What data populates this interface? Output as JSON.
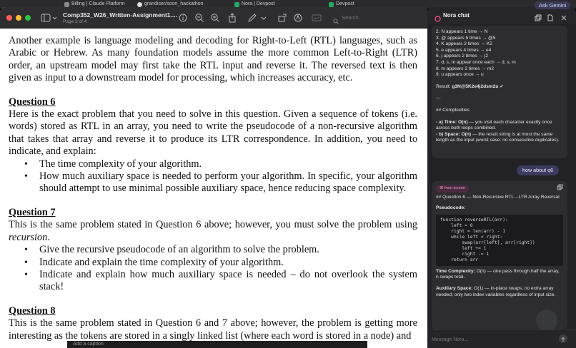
{
  "browser_tabs": [
    {
      "label": "Billing | Claude Platform",
      "icon": "claude-icon"
    },
    {
      "label": "grandiser/soon_hackathon",
      "icon": "github-icon"
    },
    {
      "label": "Nora | Devpost",
      "icon": "devpost-icon"
    },
    {
      "label": "Devpost",
      "icon": "devpost-icon"
    }
  ],
  "preview": {
    "title": "Comp352_W26_Written-Assignment1....",
    "subtitle": "Page 3 of 4",
    "search_placeholder": "Search"
  },
  "document": {
    "intro": "Another example is language modeling and decoding for Right-to-Left (RTL) languages, such as Arabic or Hebrew. As many foundation models assume the more common Left-to-Right (LTR) order, an upstream model may first take the RTL input and reverse it. The reversed text is then given as input to a downstream model for processing, which increases accuracy, etc.",
    "q6_title": "Question 6",
    "q6_body": "Here is the exact problem that you need to solve in this question. Given a sequence of tokens (i.e. words) stored as RTL in an array, you need to write the pseudocode of a non-recursive algorithm that takes that array and reverse it to produce its LTR correspondence. In addition, you need to indicate, and explain:",
    "q6_bullets": [
      "The time complexity of your algorithm.",
      "How much auxiliary space is needed to perform your algorithm. In specific, your algorithm should attempt to use minimal possible auxiliary space, hence reducing space complexity."
    ],
    "q7_title": "Question 7",
    "q7_body_a": "This is the same problem stated in Question 6 above; however, you must solve the problem using",
    "q7_body_em": "recursion",
    "q7_bullets": [
      "Give the recursive pseudocode of an algorithm to solve the problem.",
      "Indicate and explain the time complexity of your algorithm.",
      "Indicate and explain how much auxiliary space is needed – do not overlook the system stack!"
    ],
    "q8_title": "Question 8",
    "q8_body": "This is the same problem stated in Question 6 and 7 above; however, the problem is getting more interesting as the tokens are stored in a singly linked list (where each word is stored in a node) and"
  },
  "caption": {
    "placeholder": "Add a caption"
  },
  "chat": {
    "title": "Nora chat",
    "gemini_label": "Ask Gemini",
    "msg1_lines": [
      "2. N appears 1 time → N",
      "3. @ appears 5 times → @5",
      "4. K appears 2 times → K2",
      "5. e appears 4 times → e4",
      "6. j appears 2 times → j2",
      "7. d, s, m appear once each → d, s, m",
      "8. m appears 2 times → m2",
      "9. u appears once → u"
    ],
    "result_label": "Result: ",
    "result_value": "g3N@5K2e4j2dsm2u ✓",
    "sep": "---",
    "complexities_head": "## Complexities",
    "complexity_a_label": "- a) Time: O(n)",
    "complexity_a_text": " — you visit each character exactly once across both loops combined.",
    "complexity_b_label": "- b) Space: O(n)",
    "complexity_b_text": " — the result string is at most the same length as the input (worst case: no consecutive duplicates).",
    "user_msg": "how about q6",
    "from_screen": "⌘ from screen",
    "answer_head": "## Question 6 — Non-Recursive RTL→LTR Array Reversal",
    "pseudocode_label": "Pseudocode:",
    "code": "function reverseRTL(arr):\n    left = 0\n    right = len(arr) - 1\n    while left < right:\n        swap(arr[left], arr[right])\n        left += 1\n        right -= 1\n    return arr",
    "time_label": "Time Complexity:",
    "time_text": " O(n) — one pass through half the array, n swaps total.",
    "aux_label": "Auxiliary Space:",
    "aux_text": " O(1) — in-place swaps, no extra array needed; only two index variables regardless of input size.",
    "input_placeholder": "Message Nora..."
  },
  "colors": {
    "accent": "#3b3a5f",
    "from_screen": "#f29ac3",
    "traffic_red": "#ff5f57",
    "traffic_yellow": "#febc2e",
    "traffic_green": "#28c840"
  }
}
